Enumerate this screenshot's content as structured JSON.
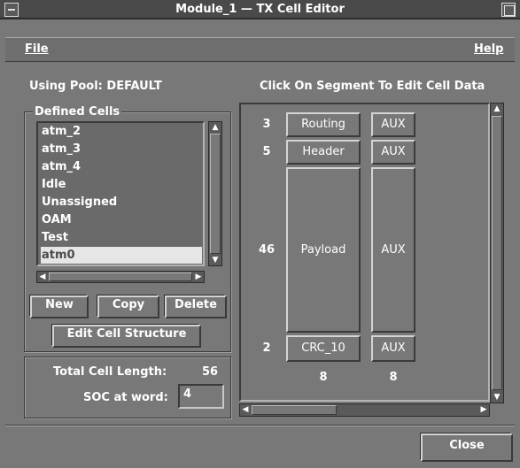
{
  "window": {
    "title": "Module_1 — TX Cell Editor"
  },
  "menu": {
    "file": "File",
    "help": "Help"
  },
  "pool_label": "Using Pool: DEFAULT",
  "instruction": "Click On Segment To Edit Cell Data",
  "defined_cells": {
    "title": "Defined Cells",
    "items": [
      "atm_2",
      "atm_3",
      "atm_4",
      "Idle",
      "Unassigned",
      "OAM",
      "Test",
      "atm0"
    ],
    "selected": "atm0"
  },
  "buttons": {
    "new": "New",
    "copy": "Copy",
    "delete": "Delete",
    "edit_structure": "Edit Cell Structure",
    "close": "Close"
  },
  "cell_info": {
    "total_length_label": "Total Cell Length:",
    "total_length_value": "56",
    "soc_label": "SOC at word:",
    "soc_value": "4"
  },
  "segments": [
    {
      "size": "3",
      "name": "Routing",
      "aux": "AUX"
    },
    {
      "size": "5",
      "name": "Header",
      "aux": "AUX"
    },
    {
      "size": "46",
      "name": "Payload",
      "aux": "AUX"
    },
    {
      "size": "2",
      "name": "CRC_10",
      "aux": "AUX"
    }
  ],
  "column_widths": {
    "main": "8",
    "aux": "8"
  },
  "icons": {
    "window_menu": "minus-icon",
    "maximize": "square-icon",
    "arrow_up": "arrow-up-icon",
    "arrow_down": "arrow-down-icon",
    "arrow_left": "arrow-left-icon",
    "arrow_right": "arrow-right-icon"
  }
}
